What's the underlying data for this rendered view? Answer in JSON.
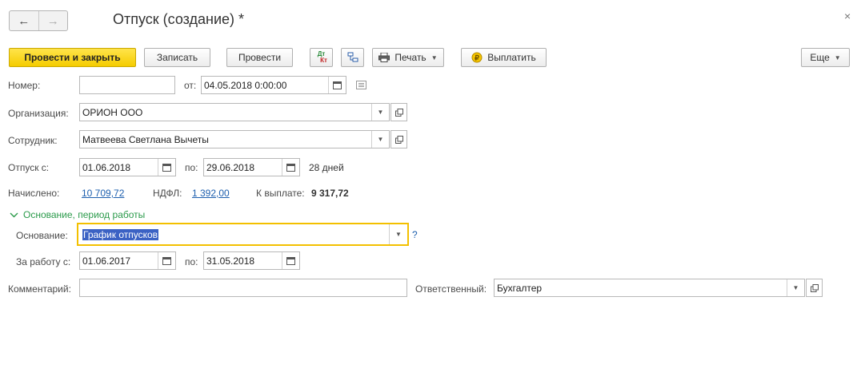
{
  "window": {
    "title": "Отпуск (создание) *",
    "close": "×"
  },
  "nav": {
    "back": "←",
    "forward": "→"
  },
  "toolbar": {
    "post_close": "Провести и закрыть",
    "save": "Записать",
    "post": "Провести",
    "dtkt_top": "Дт",
    "dtkt_bottom": "Кт",
    "print": "Печать",
    "pay": "Выплатить",
    "more": "Еще"
  },
  "fields": {
    "number_label": "Номер:",
    "number_value": "",
    "date_from_label": "от:",
    "date_value": "04.05.2018  0:00:00",
    "org_label": "Организация:",
    "org_value": "ОРИОН ООО",
    "employee_label": "Сотрудник:",
    "employee_value": "Матвеева Светлана Вычеты",
    "vacation_label": "Отпуск с:",
    "vacation_from": "01.06.2018",
    "to_label": "по:",
    "vacation_to": "29.06.2018",
    "days": "28 дней",
    "accrued_label": "Начислено:",
    "accrued_value": "10 709,72",
    "ndfl_label": "НДФЛ:",
    "ndfl_value": "1 392,00",
    "payout_label": "К выплате:",
    "payout_value": "9 317,72"
  },
  "group": {
    "title": "Основание, период работы",
    "basis_label": "Основание:",
    "basis_value": "График отпусков",
    "help": "?",
    "work_from_label": "За работу с:",
    "work_from": "01.06.2017",
    "work_to_label": "по:",
    "work_to": "31.05.2018"
  },
  "bottom": {
    "comment_label": "Комментарий:",
    "comment_value": "",
    "responsible_label": "Ответственный:",
    "responsible_value": "Бухгалтер"
  },
  "colors": {
    "primary_button": "#f5cc00",
    "focus_border": "#f3c000",
    "link": "#1d5fae",
    "group_header": "#2a9a4a",
    "selection": "#3b62c4"
  }
}
